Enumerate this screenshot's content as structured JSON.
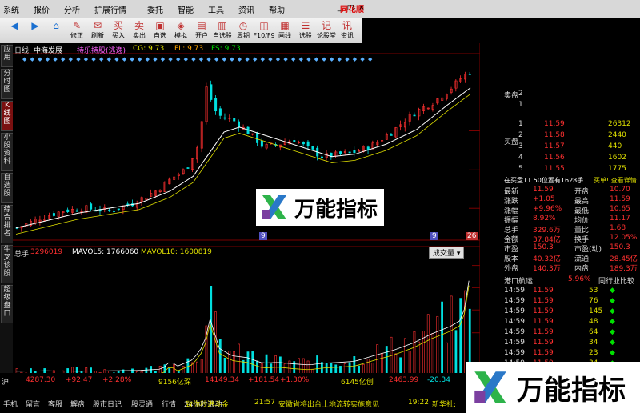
{
  "menu": {
    "items": [
      "系统",
      "报价",
      "分析",
      "扩展行情",
      "委托",
      "智能",
      "工具",
      "资讯",
      "帮助"
    ],
    "brand": "同花顺"
  },
  "toolbar": {
    "buttons": [
      {
        "icon": "◀",
        "label": ""
      },
      {
        "icon": "▶",
        "label": ""
      },
      {
        "icon": "⌂",
        "label": ""
      },
      {
        "icon": "✎",
        "label": "修正"
      },
      {
        "icon": "✉",
        "label": "刷新"
      },
      {
        "icon": "买",
        "label": "买入"
      },
      {
        "icon": "卖",
        "label": "卖出"
      },
      {
        "icon": "▣",
        "label": "自选"
      },
      {
        "icon": "◈",
        "label": "模拟"
      },
      {
        "icon": "▤",
        "label": "开户"
      },
      {
        "icon": "▥",
        "label": "自选股"
      },
      {
        "icon": "◷",
        "label": "周期"
      },
      {
        "icon": "◫",
        "label": "F10/F9"
      },
      {
        "icon": "▦",
        "label": "画线"
      },
      {
        "icon": "☰",
        "label": "选股"
      },
      {
        "icon": "记",
        "label": "论股堂"
      },
      {
        "icon": "讯",
        "label": "资讯"
      }
    ]
  },
  "sidetabs": [
    "应用",
    "分时图",
    "K线图",
    "小股资料",
    "自选股",
    "综合排名",
    "牛叉诊股",
    "超级盘口"
  ],
  "kline": {
    "header": {
      "period": "日线",
      "name": "中海发展",
      "mode": "(前复权)",
      "indicator": "持乐持股(逃逸)",
      "cg": "CG: 9.73",
      "fl": "FL: 9.73",
      "fs": "FS: 9.73"
    },
    "price_axis": [
      "8.85",
      "7.26",
      "5.70"
    ],
    "tag_left": "9",
    "tag_mid": "9",
    "tag_right": "26"
  },
  "volume": {
    "header": {
      "label": "总手",
      "value": "3296019",
      "mavol5": "MAVOL5: 1766060",
      "mavol10": "MAVOL10: 1600819"
    },
    "dropdown": "成交量",
    "axis": [
      "27512",
      "22064",
      "16611",
      "11030"
    ]
  },
  "orderbook": {
    "side_labels": {
      "ask": "卖盘",
      "bid": "买盘"
    },
    "asks": [
      {
        "level": "2",
        "price": "",
        "qty": ""
      },
      {
        "level": "1",
        "price": "",
        "qty": ""
      }
    ],
    "bids": [
      {
        "level": "1",
        "price": "11.59",
        "qty": "26312"
      },
      {
        "level": "2",
        "price": "11.58",
        "qty": "2440"
      },
      {
        "level": "3",
        "price": "11.57",
        "qty": "440"
      },
      {
        "level": "4",
        "price": "11.56",
        "qty": "1602"
      },
      {
        "level": "5",
        "price": "11.55",
        "qty": "1775"
      }
    ]
  },
  "quote": {
    "header_left": "在买盘11.50位置有1628手",
    "header_right": "买单! 查看详情",
    "rows": [
      {
        "l": "最新",
        "lv": "11.59",
        "r": "开盘",
        "rv": "10.70"
      },
      {
        "l": "涨跌",
        "lv": "+1.05",
        "r": "最高",
        "rv": "11.59"
      },
      {
        "l": "涨幅",
        "lv": "+9.96%",
        "r": "最低",
        "rv": "10.65"
      },
      {
        "l": "振幅",
        "lv": "8.92%",
        "r": "均价",
        "rv": "11.17"
      },
      {
        "l": "总手",
        "lv": "329.6万",
        "r": "量比",
        "rv": "1.68"
      },
      {
        "l": "金额",
        "lv": "37.84亿",
        "r": "换手",
        "rv": "12.05%"
      },
      {
        "l": "市盈",
        "lv": "150.3",
        "r": "市盈(动)",
        "rv": "150.3"
      },
      {
        "l": "股本",
        "lv": "40.32亿",
        "r": "流通",
        "rv": "28.45亿"
      },
      {
        "l": "外盘",
        "lv": "140.3万",
        "r": "内盘",
        "rv": "189.3万"
      }
    ],
    "industry_name": "港口航运",
    "industry_pct": "5.96%",
    "industry_compare": "同行业比较"
  },
  "ticks": [
    {
      "t": "14:59",
      "p": "11.59",
      "v": "53"
    },
    {
      "t": "14:59",
      "p": "11.59",
      "v": "76"
    },
    {
      "t": "14:59",
      "p": "11.59",
      "v": "145"
    },
    {
      "t": "14:59",
      "p": "11.59",
      "v": "48"
    },
    {
      "t": "14:59",
      "p": "11.59",
      "v": "64"
    },
    {
      "t": "14:59",
      "p": "11.59",
      "v": "34"
    },
    {
      "t": "14:59",
      "p": "11.59",
      "v": "23"
    },
    {
      "t": "14:59",
      "p": "11.59",
      "v": "34"
    },
    {
      "t": "14:59",
      "p": "11.59",
      "v": "631"
    }
  ],
  "status": {
    "sh_label": "沪",
    "sh_index": "4287.30",
    "sh_change": "+92.47",
    "sh_pct": "+2.28%",
    "sh_amount": "9156亿深",
    "sz_index": "14149.34",
    "sz_change": "+181.54",
    "sz_pct": "+1.30%",
    "sz_amount": "6145亿创",
    "cy_index": "2463.99",
    "cy_change": "-20.34",
    "bottom_tabs": [
      "手机",
      "留言",
      "客服",
      "解盘",
      "股市日记",
      "股灵通",
      "行情",
      "24小时滚动"
    ],
    "promo": "致你秒进斗金",
    "news_time": "21:57",
    "news_text": "安徽省将出台土地流转实施意见",
    "news_time2": "19:22",
    "news_source": "新华社:"
  },
  "watermark": {
    "text": "万能指标"
  },
  "colors": {
    "up": "#ff3030",
    "down": "#00e0e0",
    "ma": "#ffffff",
    "ma2": "#e0e000",
    "grid": "#7a0000"
  },
  "chart_data": [
    {
      "type": "candlestick",
      "title": "",
      "ylabel": "",
      "y_ticks": [
        5.7,
        7.26,
        8.85
      ],
      "ylim": [
        4.6,
        11.7
      ],
      "trend_points": [
        [
          0,
          4.9
        ],
        [
          15,
          5.3
        ],
        [
          30,
          5.6
        ],
        [
          45,
          5.7
        ],
        [
          60,
          5.6
        ],
        [
          75,
          5.9
        ],
        [
          90,
          6.4
        ],
        [
          100,
          6.9
        ],
        [
          110,
          7.3
        ],
        [
          118,
          8.3
        ],
        [
          123,
          10.6
        ],
        [
          130,
          9.5
        ],
        [
          140,
          9.3
        ],
        [
          150,
          8.8
        ],
        [
          160,
          8.2
        ],
        [
          170,
          8.3
        ],
        [
          180,
          8.5
        ],
        [
          190,
          8.1
        ],
        [
          198,
          7.8
        ],
        [
          210,
          7.9
        ],
        [
          220,
          8.0
        ],
        [
          232,
          8.3
        ],
        [
          245,
          8.9
        ],
        [
          258,
          9.6
        ],
        [
          270,
          10.0
        ],
        [
          282,
          10.6
        ],
        [
          290,
          11.1
        ],
        [
          295,
          11.3
        ]
      ],
      "ma": [
        [
          0,
          4.9
        ],
        [
          20,
          5.2
        ],
        [
          40,
          5.5
        ],
        [
          60,
          5.7
        ],
        [
          80,
          5.9
        ],
        [
          100,
          6.4
        ],
        [
          115,
          7.0
        ],
        [
          125,
          7.9
        ],
        [
          135,
          8.8
        ],
        [
          145,
          9.0
        ],
        [
          160,
          8.7
        ],
        [
          175,
          8.4
        ],
        [
          190,
          8.1
        ],
        [
          205,
          7.8
        ],
        [
          220,
          7.9
        ],
        [
          240,
          8.3
        ],
        [
          260,
          8.9
        ],
        [
          280,
          9.9
        ],
        [
          295,
          10.6
        ]
      ]
    },
    {
      "type": "bar",
      "title": "",
      "ylabel": "",
      "y_ticks": [
        11030,
        16611,
        22064,
        27512
      ],
      "ylim": [
        0,
        29000
      ],
      "trend_points": [
        [
          0,
          1800
        ],
        [
          20,
          1900
        ],
        [
          40,
          1800
        ],
        [
          60,
          1900
        ],
        [
          80,
          2000
        ],
        [
          95,
          2400
        ],
        [
          100,
          4500
        ],
        [
          105,
          3200
        ],
        [
          115,
          5000
        ],
        [
          122,
          9000
        ],
        [
          126,
          16000
        ],
        [
          132,
          8000
        ],
        [
          140,
          6000
        ],
        [
          150,
          5500
        ],
        [
          160,
          4000
        ],
        [
          170,
          4200
        ],
        [
          180,
          3800
        ],
        [
          190,
          3500
        ],
        [
          200,
          4000
        ],
        [
          210,
          4200
        ],
        [
          220,
          4500
        ],
        [
          232,
          6000
        ],
        [
          245,
          7500
        ],
        [
          258,
          9500
        ],
        [
          270,
          12000
        ],
        [
          282,
          14000
        ],
        [
          290,
          16000
        ],
        [
          295,
          29000
        ]
      ]
    }
  ]
}
